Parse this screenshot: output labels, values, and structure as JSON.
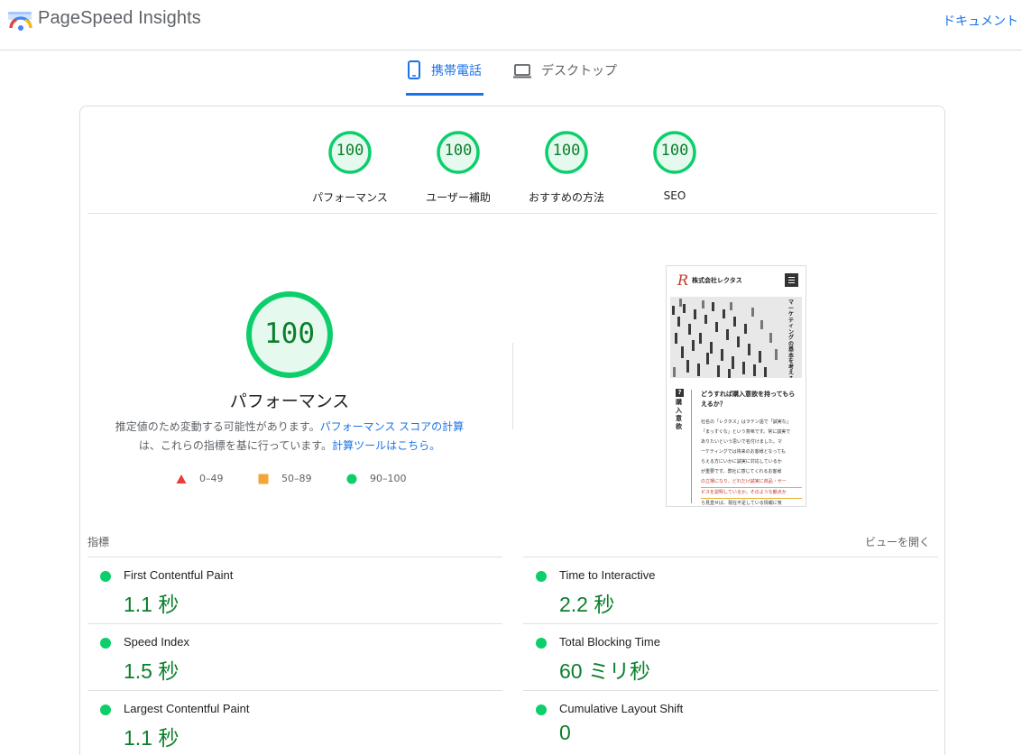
{
  "header": {
    "title": "PageSpeed Insights",
    "doc_link": "ドキュメント"
  },
  "tabs": [
    {
      "label": "携帯電話",
      "icon": "smartphone-icon",
      "active": true
    },
    {
      "label": "デスクトップ",
      "icon": "laptop-icon",
      "active": false
    }
  ],
  "categories": [
    {
      "score": "100",
      "label": "パフォーマンス"
    },
    {
      "score": "100",
      "label": "ユーザー補助"
    },
    {
      "score": "100",
      "label": "おすすめの方法"
    },
    {
      "score": "100",
      "label": "SEO"
    }
  ],
  "performance": {
    "score": "100",
    "title": "パフォーマンス",
    "desc_text_1": "推定値のため変動する可能性があります。",
    "desc_link_1": "パフォーマンス スコアの計算",
    "desc_text_2": "は、これらの指標を基に行っています。",
    "desc_link_2": "計算ツールはこちら。"
  },
  "legend": [
    {
      "range": "0–49",
      "shape": "triangle",
      "color": "#eb3b3b"
    },
    {
      "range": "50–89",
      "shape": "square",
      "color": "#f4a53a"
    },
    {
      "range": "90–100",
      "shape": "circle",
      "color": "#0cce6b"
    }
  ],
  "screenshot": {
    "brand": "株式会社レクタス",
    "hero_vertical_text": "マーケティングの基本を考える",
    "tag_vertical": "購入意欲",
    "heading": "どうすれば購入意欲を持ってもらえるか？",
    "body_lines": [
      "社名の「レクタス」はラテン語で「誠実な」",
      "「まっすぐな」という意味です。常に誠実で",
      "ありたいという思いで名付けました。マ",
      "ーケティングでは将来のお客様となっても",
      "らえる方にいかに誠実に対応しているか",
      "が重要です。弊社に感じてくれるお客様",
      "の立場になり、どれだけ誠実に商品・サー",
      "ビスを説明しているか。そのような観点か",
      "ら見直せば、現在不足している情報に気"
    ]
  },
  "metrics": {
    "heading": "指標",
    "expand_label": "ビューを開く",
    "items": [
      {
        "label": "First Contentful Paint",
        "value": "1.1 秒"
      },
      {
        "label": "Time to Interactive",
        "value": "2.2 秒"
      },
      {
        "label": "Speed Index",
        "value": "1.5 秒"
      },
      {
        "label": "Total Blocking Time",
        "value": "60 ミリ秒"
      },
      {
        "label": "Largest Contentful Paint",
        "value": "1.1 秒"
      },
      {
        "label": "Cumulative Layout Shift",
        "value": "0"
      }
    ]
  },
  "colors": {
    "accent": "#1a73e8",
    "pass": "#0cce6b",
    "pass_text": "#0c7f2c",
    "gauge_fill": "#e6f9ee"
  }
}
